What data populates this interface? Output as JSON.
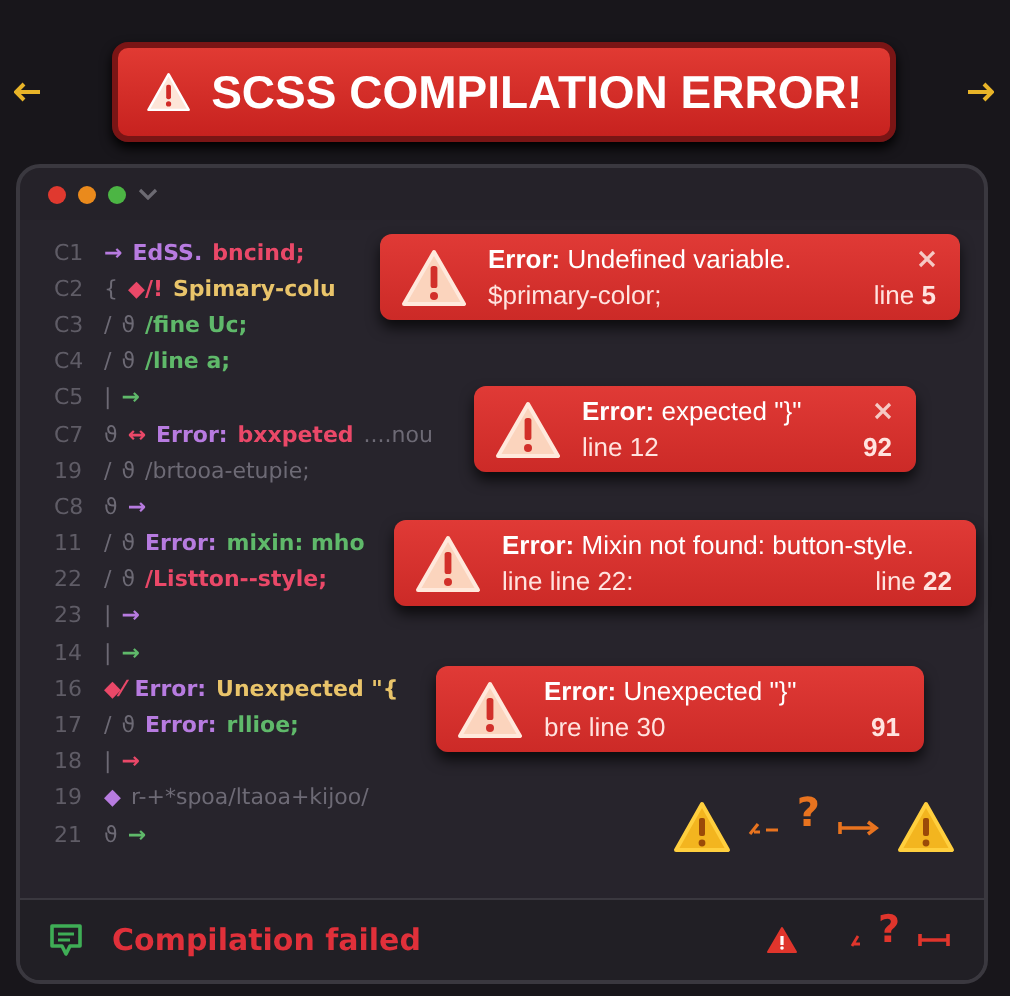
{
  "banner": {
    "title": "SCSS COMPILATION ERROR!"
  },
  "editor": {
    "lines": [
      {
        "number": "C1",
        "tokens": [
          {
            "text": "→",
            "kind": "keyword"
          },
          {
            "text": "EdSS.",
            "kind": "keyword"
          },
          {
            "text": "bncind;",
            "kind": "error"
          }
        ]
      },
      {
        "number": "C2",
        "tokens": [
          {
            "text": "{",
            "kind": "comment"
          },
          {
            "text": "◆/!",
            "kind": "error"
          },
          {
            "text": "Spimary-colu",
            "kind": "value"
          }
        ]
      },
      {
        "number": "C3",
        "tokens": [
          {
            "text": "/",
            "kind": "comment"
          },
          {
            "text": "ϑ",
            "kind": "comment"
          },
          {
            "text": "/fine Uc;",
            "kind": "name"
          }
        ]
      },
      {
        "number": "C4",
        "tokens": [
          {
            "text": "/",
            "kind": "comment"
          },
          {
            "text": "ϑ",
            "kind": "comment"
          },
          {
            "text": "/line a;",
            "kind": "name"
          }
        ]
      },
      {
        "number": "C5",
        "tokens": [
          {
            "text": "|",
            "kind": "comment"
          },
          {
            "text": "→",
            "kind": "name"
          }
        ]
      },
      {
        "number": "C7",
        "tokens": [
          {
            "text": "ϑ",
            "kind": "comment"
          },
          {
            "text": "↔",
            "kind": "error"
          },
          {
            "text": "Error:",
            "kind": "keyword"
          },
          {
            "text": "bxxpeted",
            "kind": "error"
          },
          {
            "text": "....nou",
            "kind": "comment"
          }
        ]
      },
      {
        "number": "19",
        "tokens": [
          {
            "text": "/",
            "kind": "comment"
          },
          {
            "text": "ϑ",
            "kind": "comment"
          },
          {
            "text": "/brtooa-etupie;",
            "kind": "comment"
          }
        ]
      },
      {
        "number": "C8",
        "tokens": [
          {
            "text": "ϑ",
            "kind": "comment"
          },
          {
            "text": "→",
            "kind": "keyword"
          }
        ]
      },
      {
        "number": "11",
        "tokens": [
          {
            "text": "/",
            "kind": "comment"
          },
          {
            "text": "ϑ",
            "kind": "comment"
          },
          {
            "text": "Error:",
            "kind": "keyword"
          },
          {
            "text": "mixin: mho",
            "kind": "name"
          }
        ]
      },
      {
        "number": "22",
        "tokens": [
          {
            "text": "/",
            "kind": "comment"
          },
          {
            "text": "ϑ",
            "kind": "comment"
          },
          {
            "text": "/Listton--style;",
            "kind": "error"
          }
        ]
      },
      {
        "number": "23",
        "tokens": [
          {
            "text": "|",
            "kind": "comment"
          },
          {
            "text": "→",
            "kind": "keyword"
          }
        ]
      },
      {
        "number": "14",
        "tokens": [
          {
            "text": "|",
            "kind": "comment"
          },
          {
            "text": "→",
            "kind": "name"
          }
        ]
      },
      {
        "number": "16",
        "tokens": [
          {
            "text": "◆⁄",
            "kind": "error"
          },
          {
            "text": "Error:",
            "kind": "keyword"
          },
          {
            "text": "Unexpected \"{",
            "kind": "value"
          }
        ]
      },
      {
        "number": "17",
        "tokens": [
          {
            "text": "/",
            "kind": "comment"
          },
          {
            "text": "ϑ",
            "kind": "comment"
          },
          {
            "text": "Error:",
            "kind": "keyword"
          },
          {
            "text": "rllioe;",
            "kind": "name"
          }
        ]
      },
      {
        "number": "18",
        "tokens": [
          {
            "text": "|",
            "kind": "comment"
          },
          {
            "text": "→",
            "kind": "error"
          }
        ]
      },
      {
        "number": "19",
        "tokens": [
          {
            "text": "◆",
            "kind": "keyword"
          },
          {
            "text": "r-+*spoa/ltaoa+kijoo/",
            "kind": "comment"
          }
        ]
      },
      {
        "number": "21",
        "tokens": [
          {
            "text": "ϑ",
            "kind": "comment"
          },
          {
            "text": "→",
            "kind": "name"
          }
        ]
      }
    ],
    "popups": [
      {
        "title": "**Error:** Undefined variable.",
        "detail": "$primary-color;",
        "line": "line **5**",
        "closable": true
      },
      {
        "title": "**Error:** expected \"}\"",
        "detail": "line 12",
        "line": "**92**",
        "closable": true
      },
      {
        "title": "**Error:** Mixin not found: button-style.",
        "detail": "line line 22:",
        "line": "line **22**",
        "closable": false
      },
      {
        "title": "**Error:** Unexpected \"}\"",
        "detail": "bre line 30",
        "line": "**91**",
        "closable": false
      }
    ],
    "marks": [
      {
        "text": "?"
      }
    ]
  },
  "status_bar": {
    "message": "Compilation failed",
    "marks": [
      {
        "text": "?"
      }
    ]
  }
}
